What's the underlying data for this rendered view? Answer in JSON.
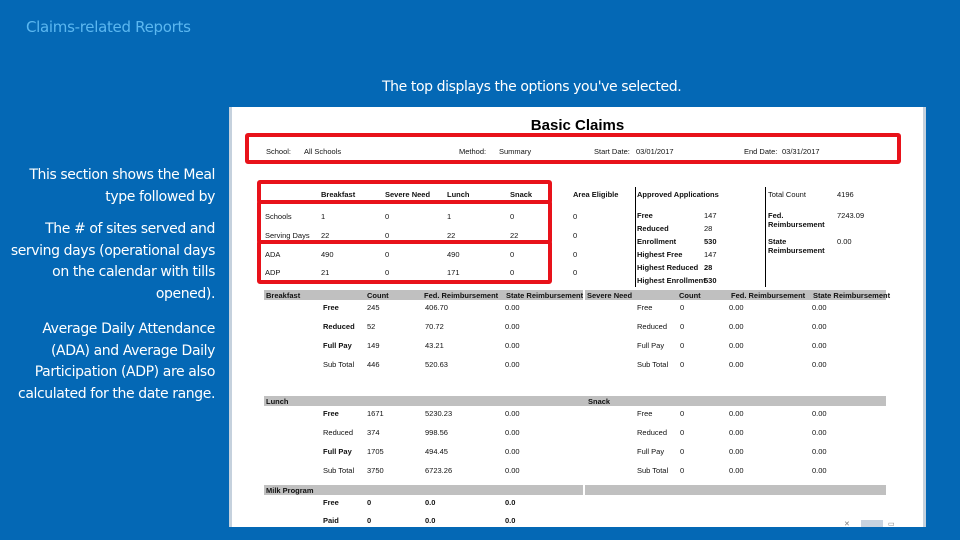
{
  "slide": {
    "title": "Claims-related Reports",
    "caption_top": "The top displays the options you've selected.",
    "notes": [
      "This section shows the Meal type followed by",
      "The # of sites served and serving days (operational days on the calendar with tills opened).",
      "Average Daily Attendance (ADA) and Average Daily Participation (ADP) are also calculated for the date range."
    ]
  },
  "report": {
    "title": "Basic Claims",
    "params": {
      "school_label": "School:",
      "school_value": "All Schools",
      "method_label": "Method:",
      "method_value": "Summary",
      "start_label": "Start Date:",
      "start_value": "03/01/2017",
      "end_label": "End Date:",
      "end_value": "03/31/2017"
    },
    "summary": {
      "headers": [
        "Breakfast",
        "Severe Need",
        "Lunch",
        "Snack",
        "Area Eligible"
      ],
      "rows": [
        {
          "label": "Schools",
          "values": [
            "1",
            "0",
            "1",
            "0",
            "0"
          ]
        },
        {
          "label": "Serving Days",
          "values": [
            "22",
            "0",
            "22",
            "22",
            "0"
          ]
        },
        {
          "label": "ADA",
          "values": [
            "490",
            "0",
            "490",
            "0",
            "0"
          ]
        },
        {
          "label": "ADP",
          "values": [
            "21",
            "0",
            "171",
            "0",
            "0"
          ]
        }
      ]
    },
    "applications": {
      "header": "Approved Applications",
      "rows": [
        {
          "label": "Free",
          "value": "147"
        },
        {
          "label": "Reduced",
          "value": "28"
        },
        {
          "label": "Enrollment",
          "value": "530"
        },
        {
          "label": "Highest Free",
          "value": "147"
        },
        {
          "label": "Highest Reduced",
          "value": "28"
        },
        {
          "label": "Highest Enrollment",
          "value": "530"
        }
      ]
    },
    "totals": {
      "total_count_label": "Total Count",
      "total_count_value": "4196",
      "fed_label": "Fed. Reimbursement",
      "fed_value": "7243.09",
      "state_label": "State Reimbursement",
      "state_value": "0.00"
    },
    "detail_columns": [
      "Count",
      "Fed. Reimbursement",
      "State Reimbursement"
    ],
    "sections": {
      "breakfast": {
        "name": "Breakfast",
        "rows": [
          {
            "label": "Free",
            "count": "245",
            "fed": "406.70",
            "state": "0.00"
          },
          {
            "label": "Reduced",
            "count": "52",
            "fed": "70.72",
            "state": "0.00"
          },
          {
            "label": "Full Pay",
            "count": "149",
            "fed": "43.21",
            "state": "0.00"
          },
          {
            "label": "Sub Total",
            "count": "446",
            "fed": "520.63",
            "state": "0.00"
          }
        ]
      },
      "severe_need": {
        "name": "Severe Need",
        "rows": [
          {
            "label": "Free",
            "count": "0",
            "fed": "0.00",
            "state": "0.00"
          },
          {
            "label": "Reduced",
            "count": "0",
            "fed": "0.00",
            "state": "0.00"
          },
          {
            "label": "Full Pay",
            "count": "0",
            "fed": "0.00",
            "state": "0.00"
          },
          {
            "label": "Sub Total",
            "count": "0",
            "fed": "0.00",
            "state": "0.00"
          }
        ]
      },
      "lunch": {
        "name": "Lunch",
        "rows": [
          {
            "label": "Free",
            "count": "1671",
            "fed": "5230.23",
            "state": "0.00"
          },
          {
            "label": "Reduced",
            "count": "374",
            "fed": "998.56",
            "state": "0.00"
          },
          {
            "label": "Full Pay",
            "count": "1705",
            "fed": "494.45",
            "state": "0.00"
          },
          {
            "label": "Sub Total",
            "count": "3750",
            "fed": "6723.26",
            "state": "0.00"
          }
        ]
      },
      "snack": {
        "name": "Snack",
        "rows": [
          {
            "label": "Free",
            "count": "0",
            "fed": "0.00",
            "state": "0.00"
          },
          {
            "label": "Reduced",
            "count": "0",
            "fed": "0.00",
            "state": "0.00"
          },
          {
            "label": "Full Pay",
            "count": "0",
            "fed": "0.00",
            "state": "0.00"
          },
          {
            "label": "Sub Total",
            "count": "0",
            "fed": "0.00",
            "state": "0.00"
          }
        ]
      },
      "milk": {
        "name": "Milk Program",
        "rows": [
          {
            "label": "Free",
            "count": "0",
            "fed": "0.0",
            "state": "0.0"
          },
          {
            "label": "Paid",
            "count": "0",
            "fed": "0.0",
            "state": "0.0"
          }
        ]
      }
    },
    "highlight_color": "#e8121a"
  }
}
